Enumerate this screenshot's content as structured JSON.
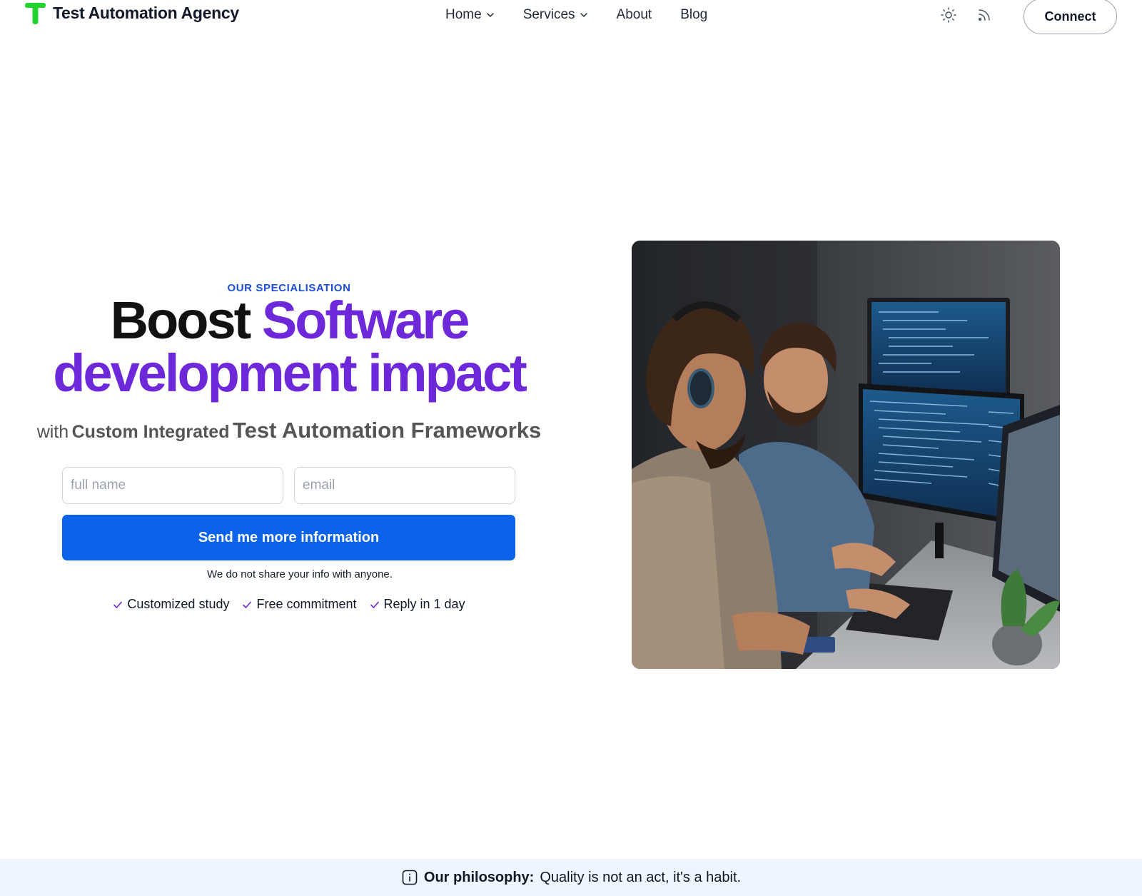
{
  "header": {
    "brand_name": "Test Automation Agency",
    "logo_color": "#22d32e",
    "nav": [
      {
        "label": "Home",
        "has_dropdown": true
      },
      {
        "label": "Services",
        "has_dropdown": true
      },
      {
        "label": "About",
        "has_dropdown": false
      },
      {
        "label": "Blog",
        "has_dropdown": false
      }
    ],
    "icons": [
      "sun-icon",
      "rss-icon"
    ],
    "connect_label": "Connect"
  },
  "hero": {
    "eyebrow": "OUR SPECIALISATION",
    "headline_dark": "Boost",
    "headline_purple_1": "Software",
    "headline_purple_2": "development impact",
    "sub_1": "with",
    "sub_2": "Custom Integrated",
    "sub_3": "Test Automation Frameworks",
    "form": {
      "name_placeholder": "full name",
      "email_placeholder": "email",
      "submit_label": "Send me more information"
    },
    "privacy_note": "We do not share your info with anyone.",
    "benefits": [
      "Customized study",
      "Free commitment",
      "Reply in 1 day"
    ],
    "colors": {
      "accent_purple": "#6d28d9",
      "eyebrow_blue": "#1d4ed8",
      "button_blue": "#0a63e8"
    }
  },
  "philosophy": {
    "label": "Our philosophy:",
    "text": "Quality is not an act, it's a habit.",
    "icon": "info-icon"
  }
}
